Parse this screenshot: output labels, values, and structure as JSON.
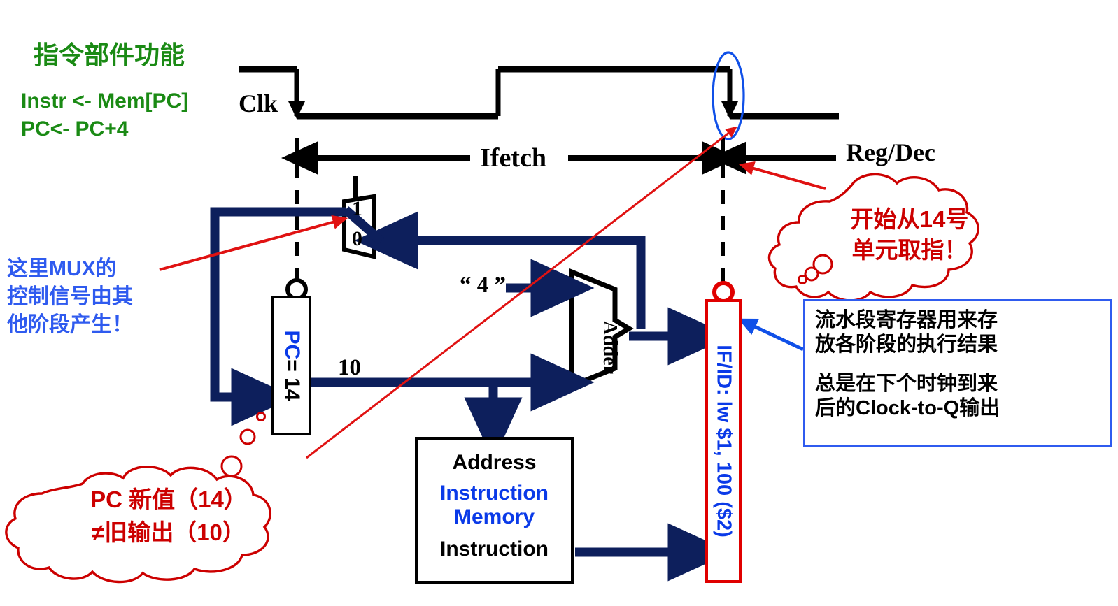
{
  "title_block": {
    "heading": "指令部件功能",
    "line1": "Instr <- Mem[PC]",
    "line2": "PC<- PC+4"
  },
  "timing": {
    "clk_label": "Clk",
    "ifetch_label": "Ifetch",
    "regdec_label": "Reg/Dec"
  },
  "datapath": {
    "mux": {
      "top_label": "1",
      "bottom_label": "0",
      "name": "mux"
    },
    "pc": {
      "label": "PC",
      "value": "= 14",
      "full": "PC = 14"
    },
    "pc_out_value": "10",
    "const_four": "“ 4 ”",
    "adder_label": "Adder",
    "memory": {
      "address": "Address",
      "mem_line1": "Instruction",
      "mem_line2": "Memory",
      "instruction_out": "Instruction"
    },
    "ifid": {
      "text": "IF/ID: lw $1, 100 ($2)"
    }
  },
  "annotations": {
    "mux_note": {
      "line1": "这里MUX的",
      "line2": "控制信号由其",
      "line3": "他阶段产生！"
    },
    "fetch_cloud": {
      "line1": "开始从14号",
      "line2": "单元取指！"
    },
    "pc_cloud": {
      "line1": "PC 新值（14）",
      "line2": "≠旧输出（10）"
    },
    "pipeline_note": {
      "para1_line1": "流水段寄存器用来存",
      "para1_line2": "放各阶段的执行结果",
      "para2_line1": "总是在下个时钟到来",
      "para2_line2": "后的Clock-to-Q输出"
    }
  },
  "colors": {
    "green": "#1a8a14",
    "navy": "#0d1f5c",
    "red": "#cc0000",
    "blue": "#0a3ae8",
    "note_blue": "#2f5bef",
    "black": "#000000"
  },
  "icons": {
    "clock_falling_edge": "down-arrow-icon",
    "highlight_ellipse": "ellipse-highlight-icon",
    "cloud_tail": "cloud-tail-bubbles-icon"
  }
}
